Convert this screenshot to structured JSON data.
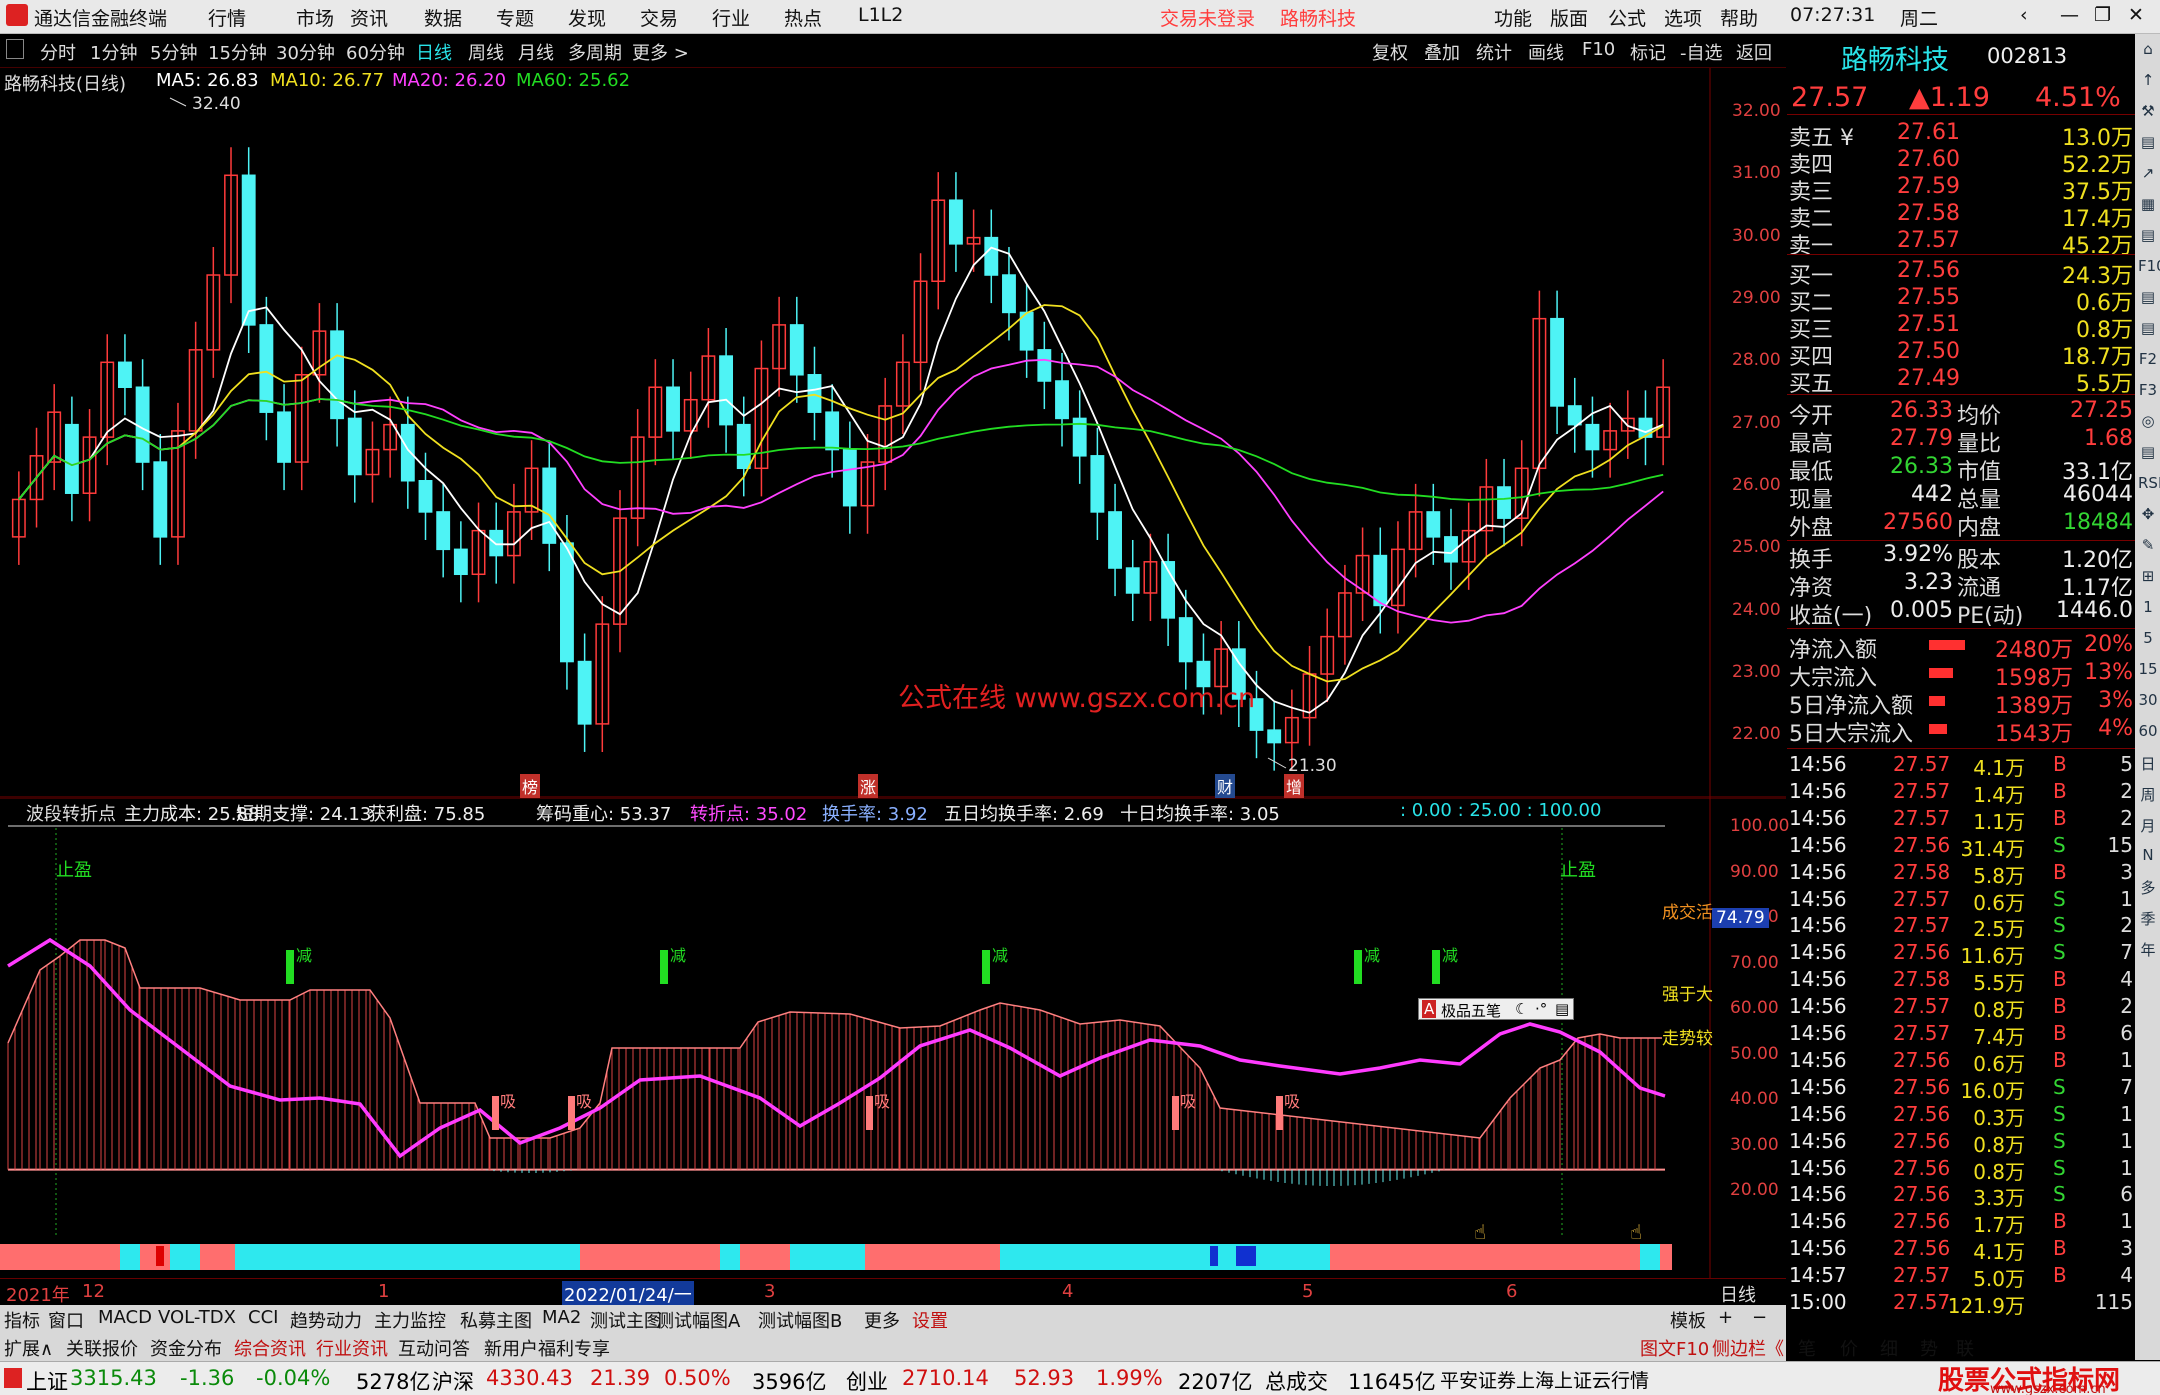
{
  "app": {
    "logo_name": "通达信金融终端",
    "menu": [
      "行情",
      "市场",
      "资讯",
      "数据",
      "专题",
      "发现",
      "交易",
      "行业",
      "热点",
      "L1L2"
    ],
    "login_status": "交易未登录",
    "stock_title": "路畅科技",
    "right_menu": [
      "功能",
      "版面",
      "公式",
      "选项",
      "帮助"
    ],
    "time": "07:27:31",
    "weekday": "周二",
    "accent_red": "#ff3d3d",
    "bg": "#000000"
  },
  "periods": [
    "分时",
    "1分钟",
    "5分钟",
    "15分钟",
    "30分钟",
    "60分钟",
    "日线",
    "周线",
    "月线",
    "多周期",
    "更多 >"
  ],
  "active_period": "日线",
  "chart_tools": [
    "复权",
    "叠加",
    "统计",
    "画线",
    "F10",
    "标记",
    "-自选",
    "返回"
  ],
  "main_chart": {
    "name": "路畅科技(日线)",
    "ma": [
      {
        "label": "MA5: 26.83",
        "color": "#ffffff"
      },
      {
        "label": "MA10: 26.77",
        "color": "#f0e020"
      },
      {
        "label": "MA20: 26.20",
        "color": "#ff40ff"
      },
      {
        "label": "MA60: 25.62",
        "color": "#22dd22"
      }
    ],
    "high_label": "32.40",
    "low_label": "21.30",
    "watermark": "公式在线  www.gszx.com.cn",
    "markers": [
      "榜",
      "涨",
      "财",
      "增"
    ],
    "price_ticks": [
      "32.00",
      "31.00",
      "30.00",
      "29.00",
      "28.00",
      "27.00",
      "26.00",
      "25.00",
      "24.00",
      "23.00",
      "22.00"
    ]
  },
  "chart_data": [
    {
      "type": "candlestick",
      "title": "路畅科技(日线)",
      "ylim": [
        21.3,
        32.4
      ],
      "series": [
        {
          "name": "MA5",
          "values": [
            26.83
          ]
        },
        {
          "name": "MA10",
          "values": [
            26.77
          ]
        },
        {
          "name": "MA20",
          "values": [
            26.2
          ]
        },
        {
          "name": "MA60",
          "values": [
            25.62
          ]
        }
      ],
      "x": [
        "2021年12",
        "1",
        "2022/01/24/一",
        "3",
        "4",
        "5",
        "6"
      ],
      "high": 32.4,
      "low": 21.3,
      "close": [
        25.8,
        26.5,
        27.2,
        25.9,
        26.8,
        28.0,
        27.6,
        26.4,
        25.2,
        26.9,
        28.2,
        29.4,
        31.0,
        28.6,
        27.2,
        26.4,
        27.8,
        28.5,
        27.1,
        26.2,
        26.6,
        27.0,
        26.1,
        25.6,
        25.0,
        24.6,
        25.3,
        24.9,
        25.6,
        26.3,
        25.1,
        23.2,
        22.2,
        23.8,
        25.5,
        26.8,
        27.6,
        26.9,
        27.4,
        28.1,
        27.0,
        26.3,
        27.9,
        28.6,
        27.8,
        27.2,
        26.6,
        25.7,
        26.4,
        27.3,
        28.0,
        29.3,
        30.6,
        29.9,
        30.0,
        29.4,
        28.8,
        28.2,
        27.7,
        27.1,
        26.5,
        25.6,
        24.7,
        24.3,
        24.8,
        23.9,
        23.2,
        22.8,
        23.4,
        22.6,
        22.1,
        21.9,
        22.3,
        23.0,
        23.6,
        24.3,
        24.9,
        24.1,
        25.0,
        25.6,
        25.2,
        24.8,
        25.3,
        26.0,
        25.5,
        26.3,
        28.7,
        27.3,
        27.0,
        26.6,
        26.9,
        27.1,
        26.8,
        27.6
      ],
      "open": [
        25.2,
        25.8,
        26.4,
        27.0,
        25.9,
        26.8,
        28.0,
        27.6,
        26.4,
        25.2,
        26.9,
        28.2,
        29.4,
        31.0,
        28.6,
        27.2,
        26.4,
        27.8,
        28.5,
        27.1,
        26.2,
        26.6,
        27.0,
        26.1,
        25.6,
        25.0,
        24.6,
        25.3,
        24.9,
        25.6,
        26.3,
        25.1,
        23.2,
        22.2,
        23.8,
        25.5,
        26.8,
        27.6,
        26.9,
        27.4,
        28.1,
        27.0,
        26.3,
        27.9,
        28.6,
        27.8,
        27.2,
        26.6,
        25.7,
        26.4,
        27.3,
        28.0,
        29.3,
        30.6,
        29.9,
        30.0,
        29.4,
        28.8,
        28.2,
        27.7,
        27.1,
        26.5,
        25.6,
        24.7,
        24.3,
        24.8,
        23.9,
        23.2,
        22.8,
        23.4,
        22.6,
        22.1,
        21.9,
        22.3,
        23.0,
        23.6,
        24.3,
        24.9,
        24.1,
        25.0,
        25.6,
        25.2,
        24.8,
        25.3,
        26.0,
        25.5,
        26.3,
        28.7,
        27.3,
        27.0,
        26.6,
        26.9,
        27.1,
        26.8
      ]
    },
    {
      "type": "line",
      "title": "波段转折点",
      "ylim": [
        20,
        100
      ],
      "series": [
        {
          "name": "主力成本",
          "values": [
            25.88
          ]
        },
        {
          "name": "短期支撑",
          "values": [
            24.13
          ]
        },
        {
          "name": "获利盘",
          "values": [
            75.85
          ]
        },
        {
          "name": "筹码重心",
          "values": [
            53.37
          ]
        },
        {
          "name": "转折点",
          "values": [
            35.02
          ]
        },
        {
          "name": "换手率",
          "values": [
            3.92
          ]
        }
      ]
    }
  ],
  "sub_chart": {
    "title": "波段转折点",
    "fields": [
      {
        "label": "主力成本: 25.88",
        "color": "#eeeeee"
      },
      {
        "label": "短期支撑: 24.13",
        "color": "#eeeeee"
      },
      {
        "label": "获利盘: 75.85",
        "color": "#eeeeee"
      },
      {
        "label": "筹码重心: 53.37",
        "color": "#eeeeee"
      },
      {
        "label": "转折点: 35.02",
        "color": "#ff4bff"
      },
      {
        "label": "换手率: 3.92",
        "color": "#8ab0ff"
      },
      {
        "label": "五日均换手率: 2.69",
        "color": "#eeeeee"
      },
      {
        "label": "十日均换手率: 3.05",
        "color": "#eeeeee"
      }
    ],
    "levels": ": 0.00 : 25.00 : 100.00",
    "ticks": [
      "100.00",
      "90.00",
      "80.00",
      "70.00",
      "60.00",
      "50.00",
      "40.00",
      "30.00",
      "20.00"
    ],
    "current_value": "74.79",
    "stop_label": "止盈",
    "cang_label": "减",
    "xi_label": "吸",
    "right_labels": [
      "成交活",
      "强于大",
      "走势较"
    ],
    "ime_label": "极品五笔"
  },
  "xaxis": {
    "labels": [
      "2021年",
      "12",
      "1",
      "2022/01/24/一",
      "3",
      "4",
      "5",
      "6"
    ],
    "mode": "日线"
  },
  "quote": {
    "name": "路畅科技",
    "code": "002813",
    "price": "27.57",
    "change": "▲1.19",
    "pct": "4.51%",
    "asks": [
      {
        "label": "卖五 ¥",
        "price": "27.61",
        "vol": "13.0万"
      },
      {
        "label": "卖四",
        "price": "27.60",
        "vol": "52.2万"
      },
      {
        "label": "卖三",
        "price": "27.59",
        "vol": "37.5万"
      },
      {
        "label": "卖二",
        "price": "27.58",
        "vol": "17.4万"
      },
      {
        "label": "卖一",
        "price": "27.57",
        "vol": "45.2万"
      }
    ],
    "bids": [
      {
        "label": "买一",
        "price": "27.56",
        "vol": "24.3万"
      },
      {
        "label": "买二",
        "price": "27.55",
        "vol": "0.6万"
      },
      {
        "label": "买三",
        "price": "27.51",
        "vol": "0.8万"
      },
      {
        "label": "买四",
        "price": "27.50",
        "vol": "18.7万"
      },
      {
        "label": "买五",
        "price": "27.49",
        "vol": "5.5万"
      }
    ],
    "stats": [
      {
        "l": "今开",
        "v": "26.33",
        "vc": "red",
        "l2": "均价",
        "v2": "27.25",
        "v2c": "red"
      },
      {
        "l": "最高",
        "v": "27.79",
        "vc": "red",
        "l2": "量比",
        "v2": "1.68",
        "v2c": "red"
      },
      {
        "l": "最低",
        "v": "26.33",
        "vc": "green",
        "l2": "市值",
        "v2": "33.1亿",
        "v2c": "white"
      },
      {
        "l": "现量",
        "v": "442",
        "vc": "white",
        "l2": "总量",
        "v2": "46044",
        "v2c": "white"
      },
      {
        "l": "外盘",
        "v": "27560",
        "vc": "red",
        "l2": "内盘",
        "v2": "18484",
        "v2c": "green"
      }
    ],
    "stats2": [
      {
        "l": "换手",
        "v": "3.92%",
        "l2": "股本",
        "v2": "1.20亿"
      },
      {
        "l": "净资",
        "v": "3.23",
        "l2": "流通",
        "v2": "1.17亿"
      },
      {
        "l": "收益(一)",
        "v": "0.005",
        "l2": "PE(动)",
        "v2": "1446.0"
      }
    ],
    "flows": [
      {
        "l": "净流入额",
        "v": "2480万",
        "p": "20%",
        "bar": 0.9
      },
      {
        "l": "大宗流入",
        "v": "1598万",
        "p": "13%",
        "bar": 0.6
      },
      {
        "l": "5日净流入额",
        "v": "1389万",
        "p": "3%",
        "bar": 0.4
      },
      {
        "l": "5日大宗流入",
        "v": "1543万",
        "p": "4%",
        "bar": 0.45
      }
    ],
    "ticks": [
      {
        "t": "14:56",
        "p": "27.57",
        "v": "4.1万",
        "s": "B",
        "n": "5"
      },
      {
        "t": "14:56",
        "p": "27.57",
        "v": "1.4万",
        "s": "B",
        "n": "2"
      },
      {
        "t": "14:56",
        "p": "27.57",
        "v": "1.1万",
        "s": "B",
        "n": "2"
      },
      {
        "t": "14:56",
        "p": "27.56",
        "v": "31.4万",
        "s": "S",
        "n": "15"
      },
      {
        "t": "14:56",
        "p": "27.58",
        "v": "5.8万",
        "s": "B",
        "n": "3"
      },
      {
        "t": "14:56",
        "p": "27.57",
        "v": "0.6万",
        "s": "S",
        "n": "1"
      },
      {
        "t": "14:56",
        "p": "27.57",
        "v": "2.5万",
        "s": "S",
        "n": "2"
      },
      {
        "t": "14:56",
        "p": "27.56",
        "v": "11.6万",
        "s": "S",
        "n": "7"
      },
      {
        "t": "14:56",
        "p": "27.58",
        "v": "5.5万",
        "s": "B",
        "n": "4"
      },
      {
        "t": "14:56",
        "p": "27.57",
        "v": "0.8万",
        "s": "B",
        "n": "2"
      },
      {
        "t": "14:56",
        "p": "27.57",
        "v": "7.4万",
        "s": "B",
        "n": "6"
      },
      {
        "t": "14:56",
        "p": "27.56",
        "v": "0.6万",
        "s": "B",
        "n": "1"
      },
      {
        "t": "14:56",
        "p": "27.56",
        "v": "16.0万",
        "s": "S",
        "n": "7"
      },
      {
        "t": "14:56",
        "p": "27.56",
        "v": "0.3万",
        "s": "S",
        "n": "1"
      },
      {
        "t": "14:56",
        "p": "27.56",
        "v": "0.8万",
        "s": "S",
        "n": "1"
      },
      {
        "t": "14:56",
        "p": "27.56",
        "v": "0.8万",
        "s": "S",
        "n": "1"
      },
      {
        "t": "14:56",
        "p": "27.56",
        "v": "3.3万",
        "s": "S",
        "n": "6"
      },
      {
        "t": "14:56",
        "p": "27.56",
        "v": "1.7万",
        "s": "B",
        "n": "1"
      },
      {
        "t": "14:56",
        "p": "27.56",
        "v": "4.1万",
        "s": "B",
        "n": "3"
      },
      {
        "t": "14:57",
        "p": "27.57",
        "v": "5.0万",
        "s": "B",
        "n": "4"
      },
      {
        "t": "15:00",
        "p": "27.57",
        "v": "121.9万",
        "s": "",
        "n": "115"
      }
    ]
  },
  "side_tools": [
    "⌂",
    "↑",
    "⚒",
    "▤",
    "↗",
    "▦",
    "▤",
    "F10",
    "▤",
    "▤",
    "F2",
    "F3",
    "◎",
    "▤",
    "RSI",
    "✥",
    "✎",
    "⊞",
    "1",
    "5",
    "15",
    "30",
    "60",
    "日",
    "周",
    "月",
    "N",
    "多",
    "季",
    "年"
  ],
  "tabs1": [
    "指标",
    "窗口",
    "MACD",
    "VOL-TDX",
    "CCI",
    "趋势动力",
    "主力监控",
    "私募主图",
    "MA2",
    "测试主图",
    "测试幅图A",
    "测试幅图B",
    "更多",
    "设置"
  ],
  "tabs1_right": [
    "模板",
    "+",
    "−"
  ],
  "tabs2": [
    "扩展∧",
    "关联报价",
    "资金分布",
    "综合资讯",
    "行业资讯",
    "互动问答",
    "新用户福利专享"
  ],
  "tabs2_right": [
    "图文F10",
    "侧边栏《",
    "笔",
    "价",
    "细",
    "势",
    "联"
  ],
  "status": [
    {
      "l": "上证",
      "v": "3315.43",
      "c": "-1.36",
      "p": "-0.04%",
      "a": "5278亿"
    },
    {
      "l": "沪深",
      "v": "4330.43",
      "c": "21.39",
      "p": "0.50%",
      "a": "3596亿"
    },
    {
      "l": "创业",
      "v": "2710.14",
      "c": "52.93",
      "p": "1.99%",
      "a": "2207亿"
    }
  ],
  "status_total_label": "总成交",
  "status_total": "11645亿",
  "status_broker": "平安证券上海上证云行情",
  "site_logo": "股票公式指标网",
  "site_url": "www.gszx.com.cn"
}
